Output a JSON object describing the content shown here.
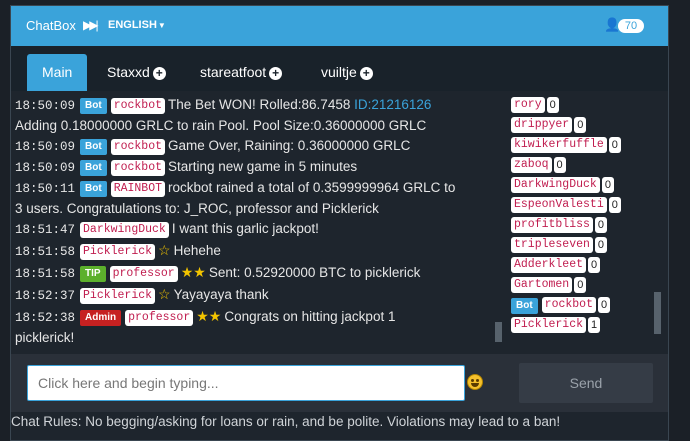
{
  "header": {
    "brand": "ChatBox",
    "brand_icon": "fast-forward-icon",
    "language": "ENGLISH",
    "online_count": "70"
  },
  "tabs": [
    {
      "label": "Main",
      "active": true
    },
    {
      "label": "Staxxd",
      "closable": true
    },
    {
      "label": "stareatfoot",
      "closable": true
    },
    {
      "label": "vuiltje",
      "closable": true
    }
  ],
  "messages": [
    {
      "time": "18:50:09",
      "badge": "Bot",
      "user": "rockbot",
      "text": "The Bet WON! Rolled:86.7458 ",
      "link": "ID:21216126"
    },
    {
      "text": "Adding 0.18000000 GRLC to rain Pool. Pool Size:0.36000000 GRLC"
    },
    {
      "time": "18:50:09",
      "badge": "Bot",
      "user": "rockbot",
      "text": "Game Over, Raining: 0.36000000 GRLC"
    },
    {
      "time": "18:50:09",
      "badge": "Bot",
      "user": "rockbot",
      "text": "Starting new game in 5 minutes"
    },
    {
      "time": "18:50:11",
      "badge": "Bot",
      "user": "RAINBOT",
      "text": "rockbot rained a total of 0.3599999964 GRLC to"
    },
    {
      "text": "3 users. Congratulations to: J_ROC, professor and Picklerick"
    },
    {
      "time": "18:51:47",
      "user": "DarkwingDuck",
      "text": "I want this garlic jackpot!"
    },
    {
      "time": "18:51:58",
      "user": "Picklerick",
      "stars": "☆",
      "text": "Hehehe"
    },
    {
      "time": "18:51:58",
      "badge": "TIP",
      "user": "professor",
      "stars": "★★",
      "text": "Sent: 0.52920000 BTC to picklerick"
    },
    {
      "time": "18:52:37",
      "user": "Picklerick",
      "stars": "☆",
      "text": "Yayayaya thank"
    },
    {
      "time": "18:52:38",
      "badge": "Admin",
      "user": "professor",
      "stars": "★★",
      "text": "Congrats on hitting jackpot 1"
    },
    {
      "text": "picklerick!"
    }
  ],
  "user_list": [
    {
      "name": "rory",
      "count": "0"
    },
    {
      "name": "drippyer",
      "count": "0"
    },
    {
      "name": "kiwikerfuffle",
      "count": "0"
    },
    {
      "name": "zaboq",
      "count": "0"
    },
    {
      "name": "DarkwingDuck",
      "count": "0"
    },
    {
      "name": "EspeonValesti",
      "count": "0"
    },
    {
      "name": "profitbliss",
      "count": "0"
    },
    {
      "name": "tripleseven",
      "count": "0"
    },
    {
      "name": "Adderkleet",
      "count": "0"
    },
    {
      "name": "Gartomen",
      "count": "0"
    },
    {
      "name": "rockbot",
      "count": "0",
      "badge": "Bot"
    },
    {
      "name": "Picklerick",
      "count": "1"
    }
  ],
  "input": {
    "placeholder": "Click here and begin typing...",
    "value": ""
  },
  "send_label": "Send",
  "emoji_icon": "smiley-icon",
  "rules": "Chat Rules: No begging/asking for loans or rain, and be polite. Violations may lead to a ban!",
  "colors": {
    "accent": "#3aa3da",
    "bot_badge": "#3aa3da",
    "tip_badge": "#5cb02c",
    "admin_badge": "#c62121",
    "username": "#c01d4f",
    "star": "#f2c400"
  }
}
